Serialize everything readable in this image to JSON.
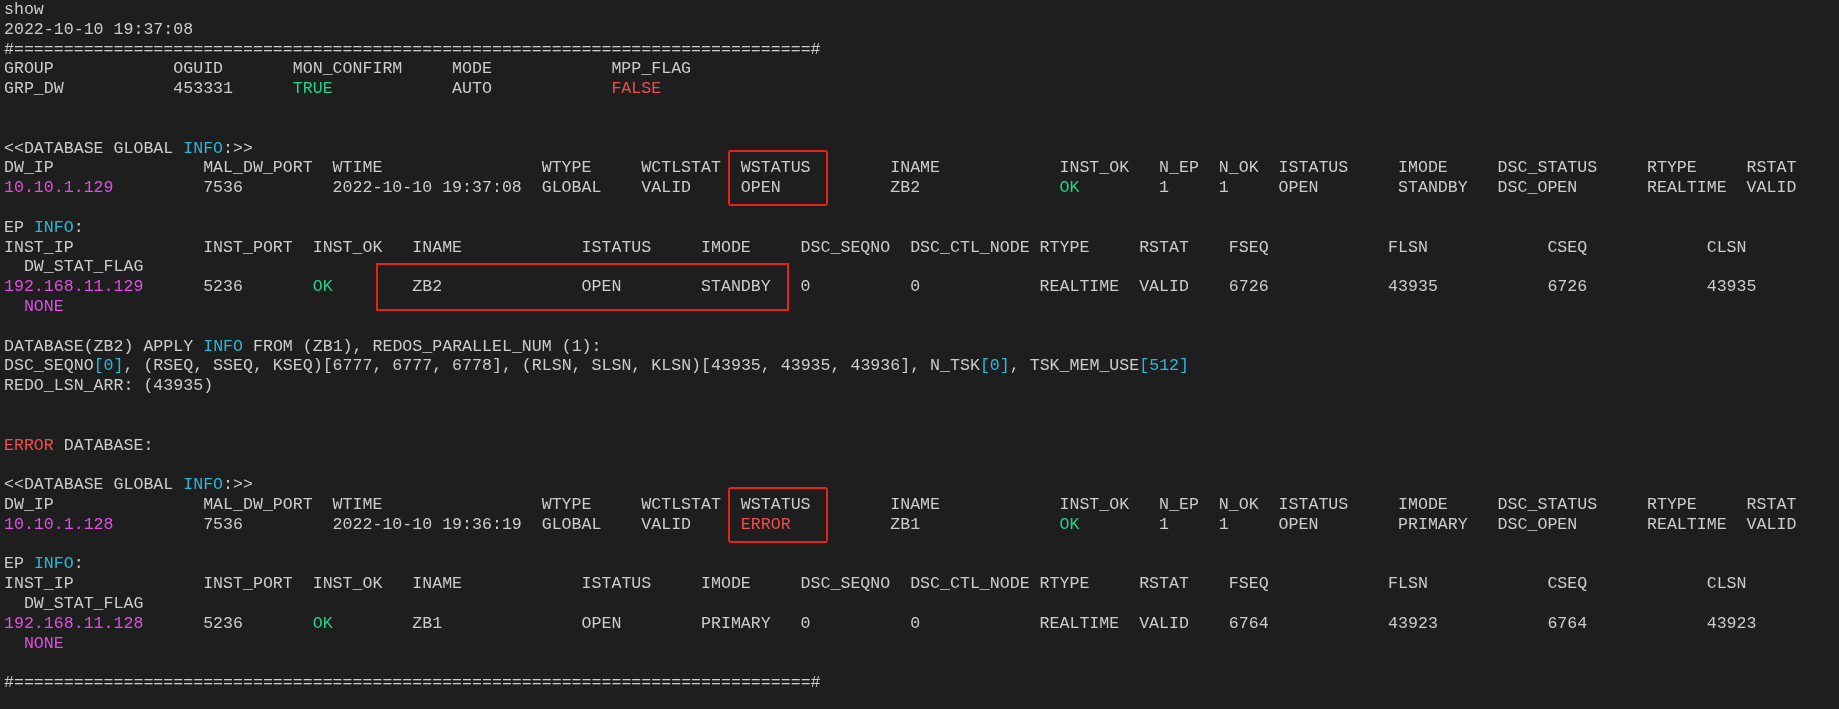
{
  "terminal": {
    "blocks": [
      {
        "kind": "line",
        "segments": [
          {
            "text": "show"
          }
        ]
      },
      {
        "kind": "line",
        "segments": [
          {
            "text": "2022-10-10 19:37:08"
          }
        ]
      },
      {
        "kind": "rule",
        "text": "#================================================================================#"
      },
      {
        "kind": "table",
        "columns": [
          {
            "header": "GROUP",
            "value": "GRP_DW"
          },
          {
            "header": "OGUID",
            "value": "453331"
          },
          {
            "header": "MON_CONFIRM",
            "value": "TRUE",
            "color": "#23d18b"
          },
          {
            "header": "MODE",
            "value": "AUTO"
          },
          {
            "header": "MPP_FLAG",
            "value": "FALSE",
            "color": "#f14c4c"
          }
        ]
      },
      {
        "kind": "blank"
      },
      {
        "kind": "blank"
      },
      {
        "kind": "line",
        "segments": [
          {
            "text": "<<DATABASE GLOBAL "
          },
          {
            "text": "INFO",
            "color": "#29b8db"
          },
          {
            "text": ":>>"
          }
        ]
      },
      {
        "kind": "table",
        "columns": [
          {
            "header": "DW_IP",
            "value": "10.10.1.129",
            "color": "#e34ce3",
            "highlighted": false
          },
          {
            "header": "MAL_DW_PORT",
            "value": "7536",
            "highlighted": false
          },
          {
            "header": "WTIME",
            "value": "2022-10-10 19:37:08",
            "highlighted": false
          },
          {
            "header": "WTYPE",
            "value": "GLOBAL",
            "highlighted": false
          },
          {
            "header": "WCTLSTAT",
            "value": "VALID",
            "highlighted": false
          },
          {
            "header": "WSTATUS",
            "value": "OPEN",
            "highlighted": true
          },
          {
            "header": "INAME",
            "value": "ZB2",
            "highlighted": false
          },
          {
            "header": "INST_OK",
            "value": "OK",
            "color": "#23d18b",
            "highlighted": false
          },
          {
            "header": "N_EP",
            "value": "1",
            "highlighted": false
          },
          {
            "header": "N_OK",
            "value": "1",
            "highlighted": false
          },
          {
            "header": "ISTATUS",
            "value": "OPEN",
            "highlighted": false
          },
          {
            "header": "IMODE",
            "value": "STANDBY",
            "highlighted": false
          },
          {
            "header": "DSC_STATUS",
            "value": "DSC_OPEN",
            "highlighted": false
          },
          {
            "header": "RTYPE",
            "value": "REALTIME",
            "highlighted": false
          },
          {
            "header": "RSTAT",
            "value": "VALID",
            "highlighted": false
          }
        ]
      },
      {
        "kind": "blank"
      },
      {
        "kind": "line",
        "segments": [
          {
            "text": "EP "
          },
          {
            "text": "INFO",
            "color": "#29b8db"
          },
          {
            "text": ":"
          }
        ]
      },
      {
        "kind": "table",
        "columns": [
          {
            "header": "INST_IP",
            "value": "192.168.11.129",
            "color": "#e34ce3",
            "highlighted": false
          },
          {
            "header": "INST_PORT",
            "value": "5236",
            "highlighted": false
          },
          {
            "header": "INST_OK",
            "value": "OK",
            "color": "#23d18b",
            "highlighted": false
          },
          {
            "header": "INAME",
            "value": "ZB2",
            "highlighted": true
          },
          {
            "header": "ISTATUS",
            "value": "OPEN",
            "highlighted": true
          },
          {
            "header": "IMODE",
            "value": "STANDBY",
            "highlighted": true
          },
          {
            "header": "DSC_SEQNO",
            "value": "0",
            "highlighted": false
          },
          {
            "header": "DSC_CTL_NODE",
            "value": "0",
            "highlighted": false
          },
          {
            "header": "RTYPE",
            "value": "REALTIME",
            "highlighted": false
          },
          {
            "header": "RSTAT",
            "value": "VALID",
            "highlighted": false
          },
          {
            "header": "FSEQ",
            "value": "6726",
            "highlighted": false
          },
          {
            "header": "FLSN",
            "value": "43935",
            "highlighted": false
          },
          {
            "header": "CSEQ",
            "value": "6726",
            "highlighted": false
          },
          {
            "header": "CLSN",
            "value": "43935",
            "highlighted": false
          }
        ],
        "wrapped_column": {
          "header": "DW_STAT_FLAG",
          "value": "NONE",
          "color": "#e34ce3"
        }
      },
      {
        "kind": "blank"
      },
      {
        "kind": "line",
        "segments": [
          {
            "text": "DATABASE(ZB2) APPLY "
          },
          {
            "text": "INFO",
            "color": "#29b8db"
          },
          {
            "text": " FROM (ZB1), REDOS_PARALLEL_NUM (1):"
          }
        ]
      },
      {
        "kind": "line",
        "segments": [
          {
            "text": "DSC_SEQNO"
          },
          {
            "text": "[0]",
            "color": "#29b8db"
          },
          {
            "text": ", (RSEQ, SSEQ, KSEQ)[6777, 6777, 6778], (RLSN, SLSN, KLSN)[43935, 43935, 43936], N_TSK"
          },
          {
            "text": "[0]",
            "color": "#29b8db"
          },
          {
            "text": ", TSK_MEM_USE"
          },
          {
            "text": "[512]",
            "color": "#29b8db"
          }
        ]
      },
      {
        "kind": "line",
        "segments": [
          {
            "text": "REDO_LSN_ARR: (43935)"
          }
        ]
      },
      {
        "kind": "blank"
      },
      {
        "kind": "blank"
      },
      {
        "kind": "line",
        "segments": [
          {
            "text": "ERROR",
            "color": "#f14c4c"
          },
          {
            "text": " DATABASE:"
          }
        ]
      },
      {
        "kind": "blank"
      },
      {
        "kind": "line",
        "segments": [
          {
            "text": "<<DATABASE GLOBAL "
          },
          {
            "text": "INFO",
            "color": "#29b8db"
          },
          {
            "text": ":>>"
          }
        ]
      },
      {
        "kind": "table",
        "columns": [
          {
            "header": "DW_IP",
            "value": "10.10.1.128",
            "color": "#e34ce3",
            "highlighted": false
          },
          {
            "header": "MAL_DW_PORT",
            "value": "7536",
            "highlighted": false
          },
          {
            "header": "WTIME",
            "value": "2022-10-10 19:36:19",
            "highlighted": false
          },
          {
            "header": "WTYPE",
            "value": "GLOBAL",
            "highlighted": false
          },
          {
            "header": "WCTLSTAT",
            "value": "VALID",
            "highlighted": false
          },
          {
            "header": "WSTATUS",
            "value": "ERROR",
            "color": "#f14c4c",
            "highlighted": true
          },
          {
            "header": "INAME",
            "value": "ZB1",
            "highlighted": false
          },
          {
            "header": "INST_OK",
            "value": "OK",
            "color": "#23d18b",
            "highlighted": false
          },
          {
            "header": "N_EP",
            "value": "1",
            "highlighted": false
          },
          {
            "header": "N_OK",
            "value": "1",
            "highlighted": false
          },
          {
            "header": "ISTATUS",
            "value": "OPEN",
            "highlighted": false
          },
          {
            "header": "IMODE",
            "value": "PRIMARY",
            "highlighted": false
          },
          {
            "header": "DSC_STATUS",
            "value": "DSC_OPEN",
            "highlighted": false
          },
          {
            "header": "RTYPE",
            "value": "REALTIME",
            "highlighted": false
          },
          {
            "header": "RSTAT",
            "value": "VALID",
            "highlighted": false
          }
        ]
      },
      {
        "kind": "blank"
      },
      {
        "kind": "line",
        "segments": [
          {
            "text": "EP "
          },
          {
            "text": "INFO",
            "color": "#29b8db"
          },
          {
            "text": ":"
          }
        ]
      },
      {
        "kind": "table",
        "columns": [
          {
            "header": "INST_IP",
            "value": "192.168.11.128",
            "color": "#e34ce3",
            "highlighted": false
          },
          {
            "header": "INST_PORT",
            "value": "5236",
            "highlighted": false
          },
          {
            "header": "INST_OK",
            "value": "OK",
            "color": "#23d18b",
            "highlighted": false
          },
          {
            "header": "INAME",
            "value": "ZB1",
            "highlighted": false
          },
          {
            "header": "ISTATUS",
            "value": "OPEN",
            "highlighted": false
          },
          {
            "header": "IMODE",
            "value": "PRIMARY",
            "highlighted": false
          },
          {
            "header": "DSC_SEQNO",
            "value": "0",
            "highlighted": false
          },
          {
            "header": "DSC_CTL_NODE",
            "value": "0",
            "highlighted": false
          },
          {
            "header": "RTYPE",
            "value": "REALTIME",
            "highlighted": false
          },
          {
            "header": "RSTAT",
            "value": "VALID",
            "highlighted": false
          },
          {
            "header": "FSEQ",
            "value": "6764",
            "highlighted": false
          },
          {
            "header": "FLSN",
            "value": "43923",
            "highlighted": false
          },
          {
            "header": "CSEQ",
            "value": "6764",
            "highlighted": false
          },
          {
            "header": "CLSN",
            "value": "43923",
            "highlighted": false
          }
        ],
        "wrapped_column": {
          "header": "DW_STAT_FLAG",
          "value": "NONE",
          "color": "#e34ce3"
        }
      },
      {
        "kind": "blank"
      },
      {
        "kind": "rule",
        "text": "#================================================================================#"
      }
    ]
  }
}
